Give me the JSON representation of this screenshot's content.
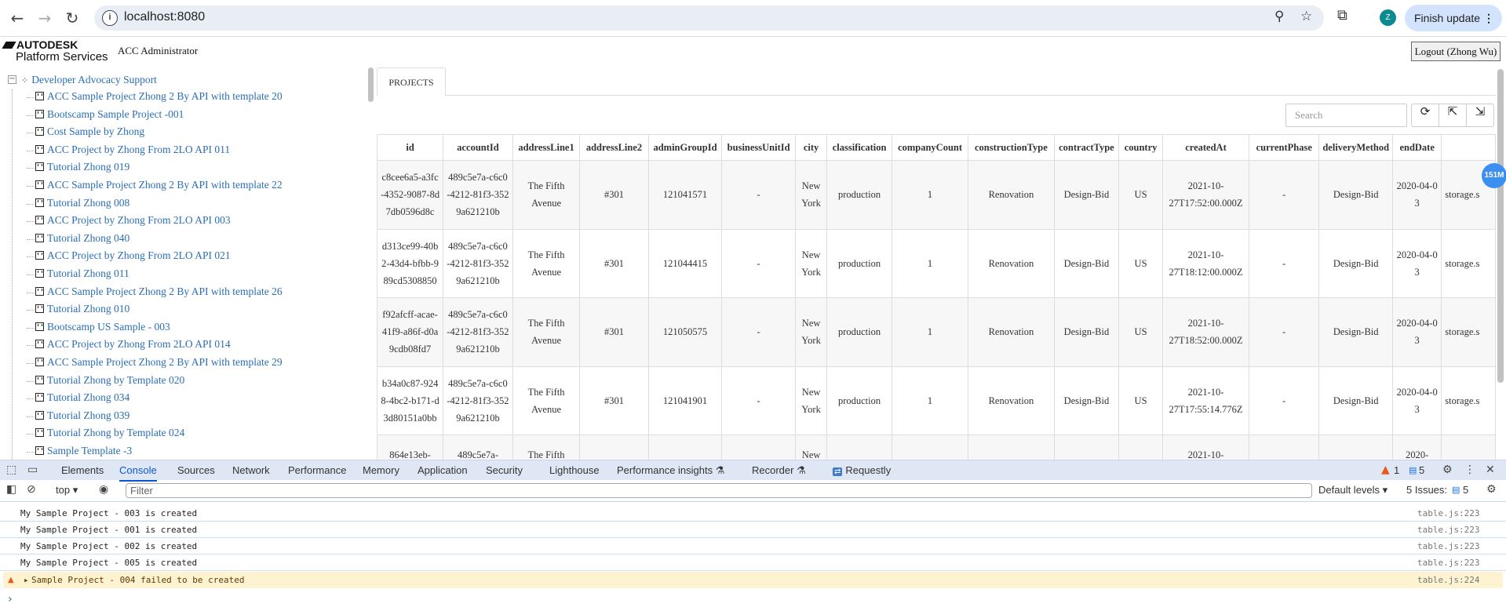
{
  "browser": {
    "url": "localhost:8080",
    "finish_update": "Finish update",
    "profile_initial": "Z"
  },
  "header": {
    "logo_line1": "AUTODESK",
    "logo_line2": "Platform Services",
    "app_title": "ACC Administrator",
    "logout": "Logout (Zhong Wu)"
  },
  "tree": {
    "root": "Developer Advocacy Support",
    "items": [
      "ACC Sample Project Zhong 2 By API with template 20",
      "Bootscamp Sample Project -001",
      "Cost Sample by Zhong",
      "ACC Project by Zhong From 2LO API 011",
      "Tutorial Zhong 019",
      "ACC Sample Project Zhong 2 By API with template 22",
      "Tutorial Zhong 008",
      "ACC Project by Zhong From 2LO API 003",
      "Tutorial Zhong 040",
      "ACC Project by Zhong From 2LO API 021",
      "Tutorial Zhong 011",
      "ACC Sample Project Zhong 2 By API with template 26",
      "Tutorial Zhong 010",
      "Bootscamp US Sample - 003",
      "ACC Project by Zhong From 2LO API 014",
      "ACC Sample Project Zhong 2 By API with template 29",
      "Tutorial Zhong by Template 020",
      "Tutorial Zhong 034",
      "Tutorial Zhong 039",
      "Tutorial Zhong by Template 024",
      "Sample Template -3"
    ]
  },
  "main": {
    "tab": "PROJECTS",
    "search_placeholder": "Search",
    "memory_badge": "151M",
    "columns": [
      "id",
      "accountId",
      "addressLine1",
      "addressLine2",
      "adminGroupId",
      "businessUnitId",
      "city",
      "classification",
      "companyCount",
      "constructionType",
      "contractType",
      "country",
      "createdAt",
      "currentPhase",
      "deliveryMethod",
      "endDate",
      ""
    ],
    "rows": [
      [
        "c8cee6a5-a3fc-4352-9087-8d7db0596d8c",
        "489c5e7a-c6c0-4212-81f3-3529a621210b",
        "The Fifth Avenue",
        "#301",
        "121041571",
        "-",
        "New York",
        "production",
        "1",
        "Renovation",
        "Design-Bid",
        "US",
        "2021-10-27T17:52:00.000Z",
        "-",
        "Design-Bid",
        "2020-04-03",
        "storage.s"
      ],
      [
        "d313ce99-40b2-43d4-bfbb-989cd5308850",
        "489c5e7a-c6c0-4212-81f3-3529a621210b",
        "The Fifth Avenue",
        "#301",
        "121044415",
        "-",
        "New York",
        "production",
        "1",
        "Renovation",
        "Design-Bid",
        "US",
        "2021-10-27T18:12:00.000Z",
        "-",
        "Design-Bid",
        "2020-04-03",
        "storage.s"
      ],
      [
        "f92afcff-acae-41f9-a86f-d0a9cdb08fd7",
        "489c5e7a-c6c0-4212-81f3-3529a621210b",
        "The Fifth Avenue",
        "#301",
        "121050575",
        "-",
        "New York",
        "production",
        "1",
        "Renovation",
        "Design-Bid",
        "US",
        "2021-10-27T18:52:00.000Z",
        "-",
        "Design-Bid",
        "2020-04-03",
        "storage.s"
      ],
      [
        "b34a0c87-9248-4bc2-b171-d3d80151a0bb",
        "489c5e7a-c6c0-4212-81f3-3529a621210b",
        "The Fifth Avenue",
        "#301",
        "121041901",
        "-",
        "New York",
        "production",
        "1",
        "Renovation",
        "Design-Bid",
        "US",
        "2021-10-27T17:55:14.776Z",
        "-",
        "Design-Bid",
        "2020-04-03",
        "storage.s"
      ],
      [
        "864e13eb-",
        "489c5e7a-",
        "The Fifth",
        "",
        "",
        "",
        "New",
        "",
        "",
        "",
        "",
        "",
        "2021-10-",
        "",
        "",
        "2020-",
        ""
      ]
    ]
  },
  "devtools": {
    "tabs": [
      "Elements",
      "Console",
      "Sources",
      "Network",
      "Performance",
      "Memory",
      "Application",
      "Security",
      "Lighthouse",
      "Performance insights",
      "Recorder",
      "Requestly"
    ],
    "active_tab": "Console",
    "warning_count": "1",
    "message_count": "5",
    "context": "top",
    "filter_placeholder": "Filter",
    "levels": "Default levels",
    "issues_label": "5 Issues:",
    "issues_count": "5",
    "logs": [
      {
        "msg": "My Sample Project - 003 is created",
        "src": "table.js:223",
        "level": "info"
      },
      {
        "msg": "My Sample Project - 001 is created",
        "src": "table.js:223",
        "level": "info"
      },
      {
        "msg": "My Sample Project - 002 is created",
        "src": "table.js:223",
        "level": "info"
      },
      {
        "msg": "My Sample Project - 005 is created",
        "src": "table.js:223",
        "level": "info"
      },
      {
        "msg": "Sample Project - 004 failed to be created",
        "src": "table.js:224",
        "level": "warning"
      }
    ]
  }
}
